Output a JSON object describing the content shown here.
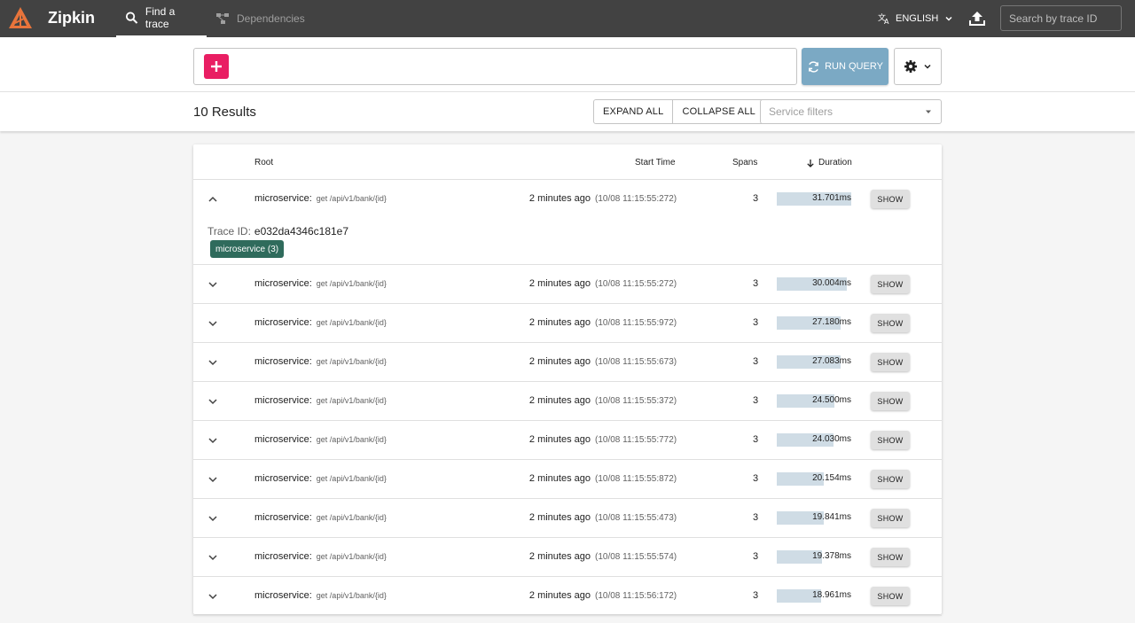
{
  "app": {
    "title": "Zipkin"
  },
  "nav": {
    "tabs": [
      {
        "label": "Find a trace",
        "icon": "search-icon",
        "active": true
      },
      {
        "label": "Dependencies",
        "icon": "dependencies-icon",
        "active": false
      }
    ],
    "language": "ENGLISH",
    "trace_search_placeholder": "Search by trace ID"
  },
  "query": {
    "run_label": "RUN QUERY"
  },
  "results": {
    "count_label": "10 Results",
    "expand_all": "EXPAND ALL",
    "collapse_all": "COLLAPSE ALL",
    "service_filter_placeholder": "Service filters"
  },
  "table": {
    "columns": {
      "root": "Root",
      "start": "Start Time",
      "spans": "Spans",
      "duration": "Duration"
    },
    "show_label": "SHOW",
    "trace_id_label": "Trace ID:",
    "rows": [
      {
        "service": "microservice:",
        "op": "get /api/v1/bank/{id}",
        "rel": "2 minutes ago",
        "abs": "(10/08 11:15:55:272)",
        "spans": "3",
        "duration": "31.701ms",
        "pct": 1.0,
        "expanded": true,
        "trace_id": "e032da4346c181e7",
        "chip": "microservice (3)"
      },
      {
        "service": "microservice:",
        "op": "get /api/v1/bank/{id}",
        "rel": "2 minutes ago",
        "abs": "(10/08 11:15:55:272)",
        "spans": "3",
        "duration": "30.004ms",
        "pct": 0.946
      },
      {
        "service": "microservice:",
        "op": "get /api/v1/bank/{id}",
        "rel": "2 minutes ago",
        "abs": "(10/08 11:15:55:972)",
        "spans": "3",
        "duration": "27.180ms",
        "pct": 0.857
      },
      {
        "service": "microservice:",
        "op": "get /api/v1/bank/{id}",
        "rel": "2 minutes ago",
        "abs": "(10/08 11:15:55:673)",
        "spans": "3",
        "duration": "27.083ms",
        "pct": 0.854
      },
      {
        "service": "microservice:",
        "op": "get /api/v1/bank/{id}",
        "rel": "2 minutes ago",
        "abs": "(10/08 11:15:55:372)",
        "spans": "3",
        "duration": "24.500ms",
        "pct": 0.773
      },
      {
        "service": "microservice:",
        "op": "get /api/v1/bank/{id}",
        "rel": "2 minutes ago",
        "abs": "(10/08 11:15:55:772)",
        "spans": "3",
        "duration": "24.030ms",
        "pct": 0.758
      },
      {
        "service": "microservice:",
        "op": "get /api/v1/bank/{id}",
        "rel": "2 minutes ago",
        "abs": "(10/08 11:15:55:872)",
        "spans": "3",
        "duration": "20.154ms",
        "pct": 0.636
      },
      {
        "service": "microservice:",
        "op": "get /api/v1/bank/{id}",
        "rel": "2 minutes ago",
        "abs": "(10/08 11:15:55:473)",
        "spans": "3",
        "duration": "19.841ms",
        "pct": 0.626
      },
      {
        "service": "microservice:",
        "op": "get /api/v1/bank/{id}",
        "rel": "2 minutes ago",
        "abs": "(10/08 11:15:55:574)",
        "spans": "3",
        "duration": "19.378ms",
        "pct": 0.611
      },
      {
        "service": "microservice:",
        "op": "get /api/v1/bank/{id}",
        "rel": "2 minutes ago",
        "abs": "(10/08 11:15:56:172)",
        "spans": "3",
        "duration": "18.961ms",
        "pct": 0.598
      }
    ]
  },
  "colors": {
    "topbar": "#424242",
    "add_button": "#e91e63",
    "run_button": "#7ba9c4",
    "duration_bar": "#cfdce5",
    "service_chip": "#2f6b5c",
    "logo": "#e8743b"
  }
}
